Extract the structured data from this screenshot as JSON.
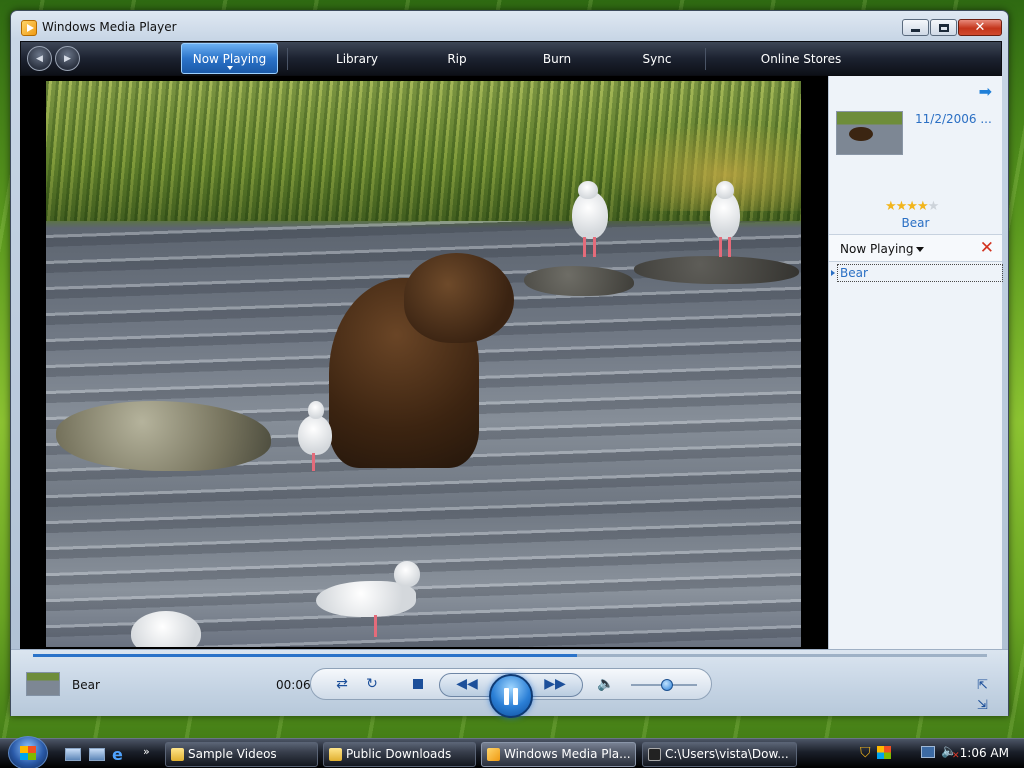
{
  "window": {
    "title": "Windows Media Player"
  },
  "nav": {
    "back_glyph": "◀",
    "forward_glyph": "▶",
    "tabs": [
      "Now Playing",
      "Library",
      "Rip",
      "Burn",
      "Sync",
      "Online Stores"
    ]
  },
  "info_pane": {
    "date": "11/2/2006 ...",
    "rating_stars_on": "★★★★",
    "rating_stars_off": "★",
    "rating_value": 4,
    "rating_max": 5,
    "title": "Bear",
    "list_label": "Now Playing",
    "playlist": [
      "Bear"
    ]
  },
  "controls": {
    "track_name": "Bear",
    "elapsed": "00:06",
    "seek_fraction": 0.57,
    "volume_fraction": 0.5
  },
  "taskbar": {
    "tasks": [
      "Sample Videos",
      "Public Downloads",
      "Windows Media Pla...",
      "C:\\Users\\vista\\Dow..."
    ],
    "clock": "1:06 AM"
  },
  "colors": {
    "accent": "#2b73c9",
    "link": "#2a6fc4",
    "toolbar": "#1c2230"
  }
}
